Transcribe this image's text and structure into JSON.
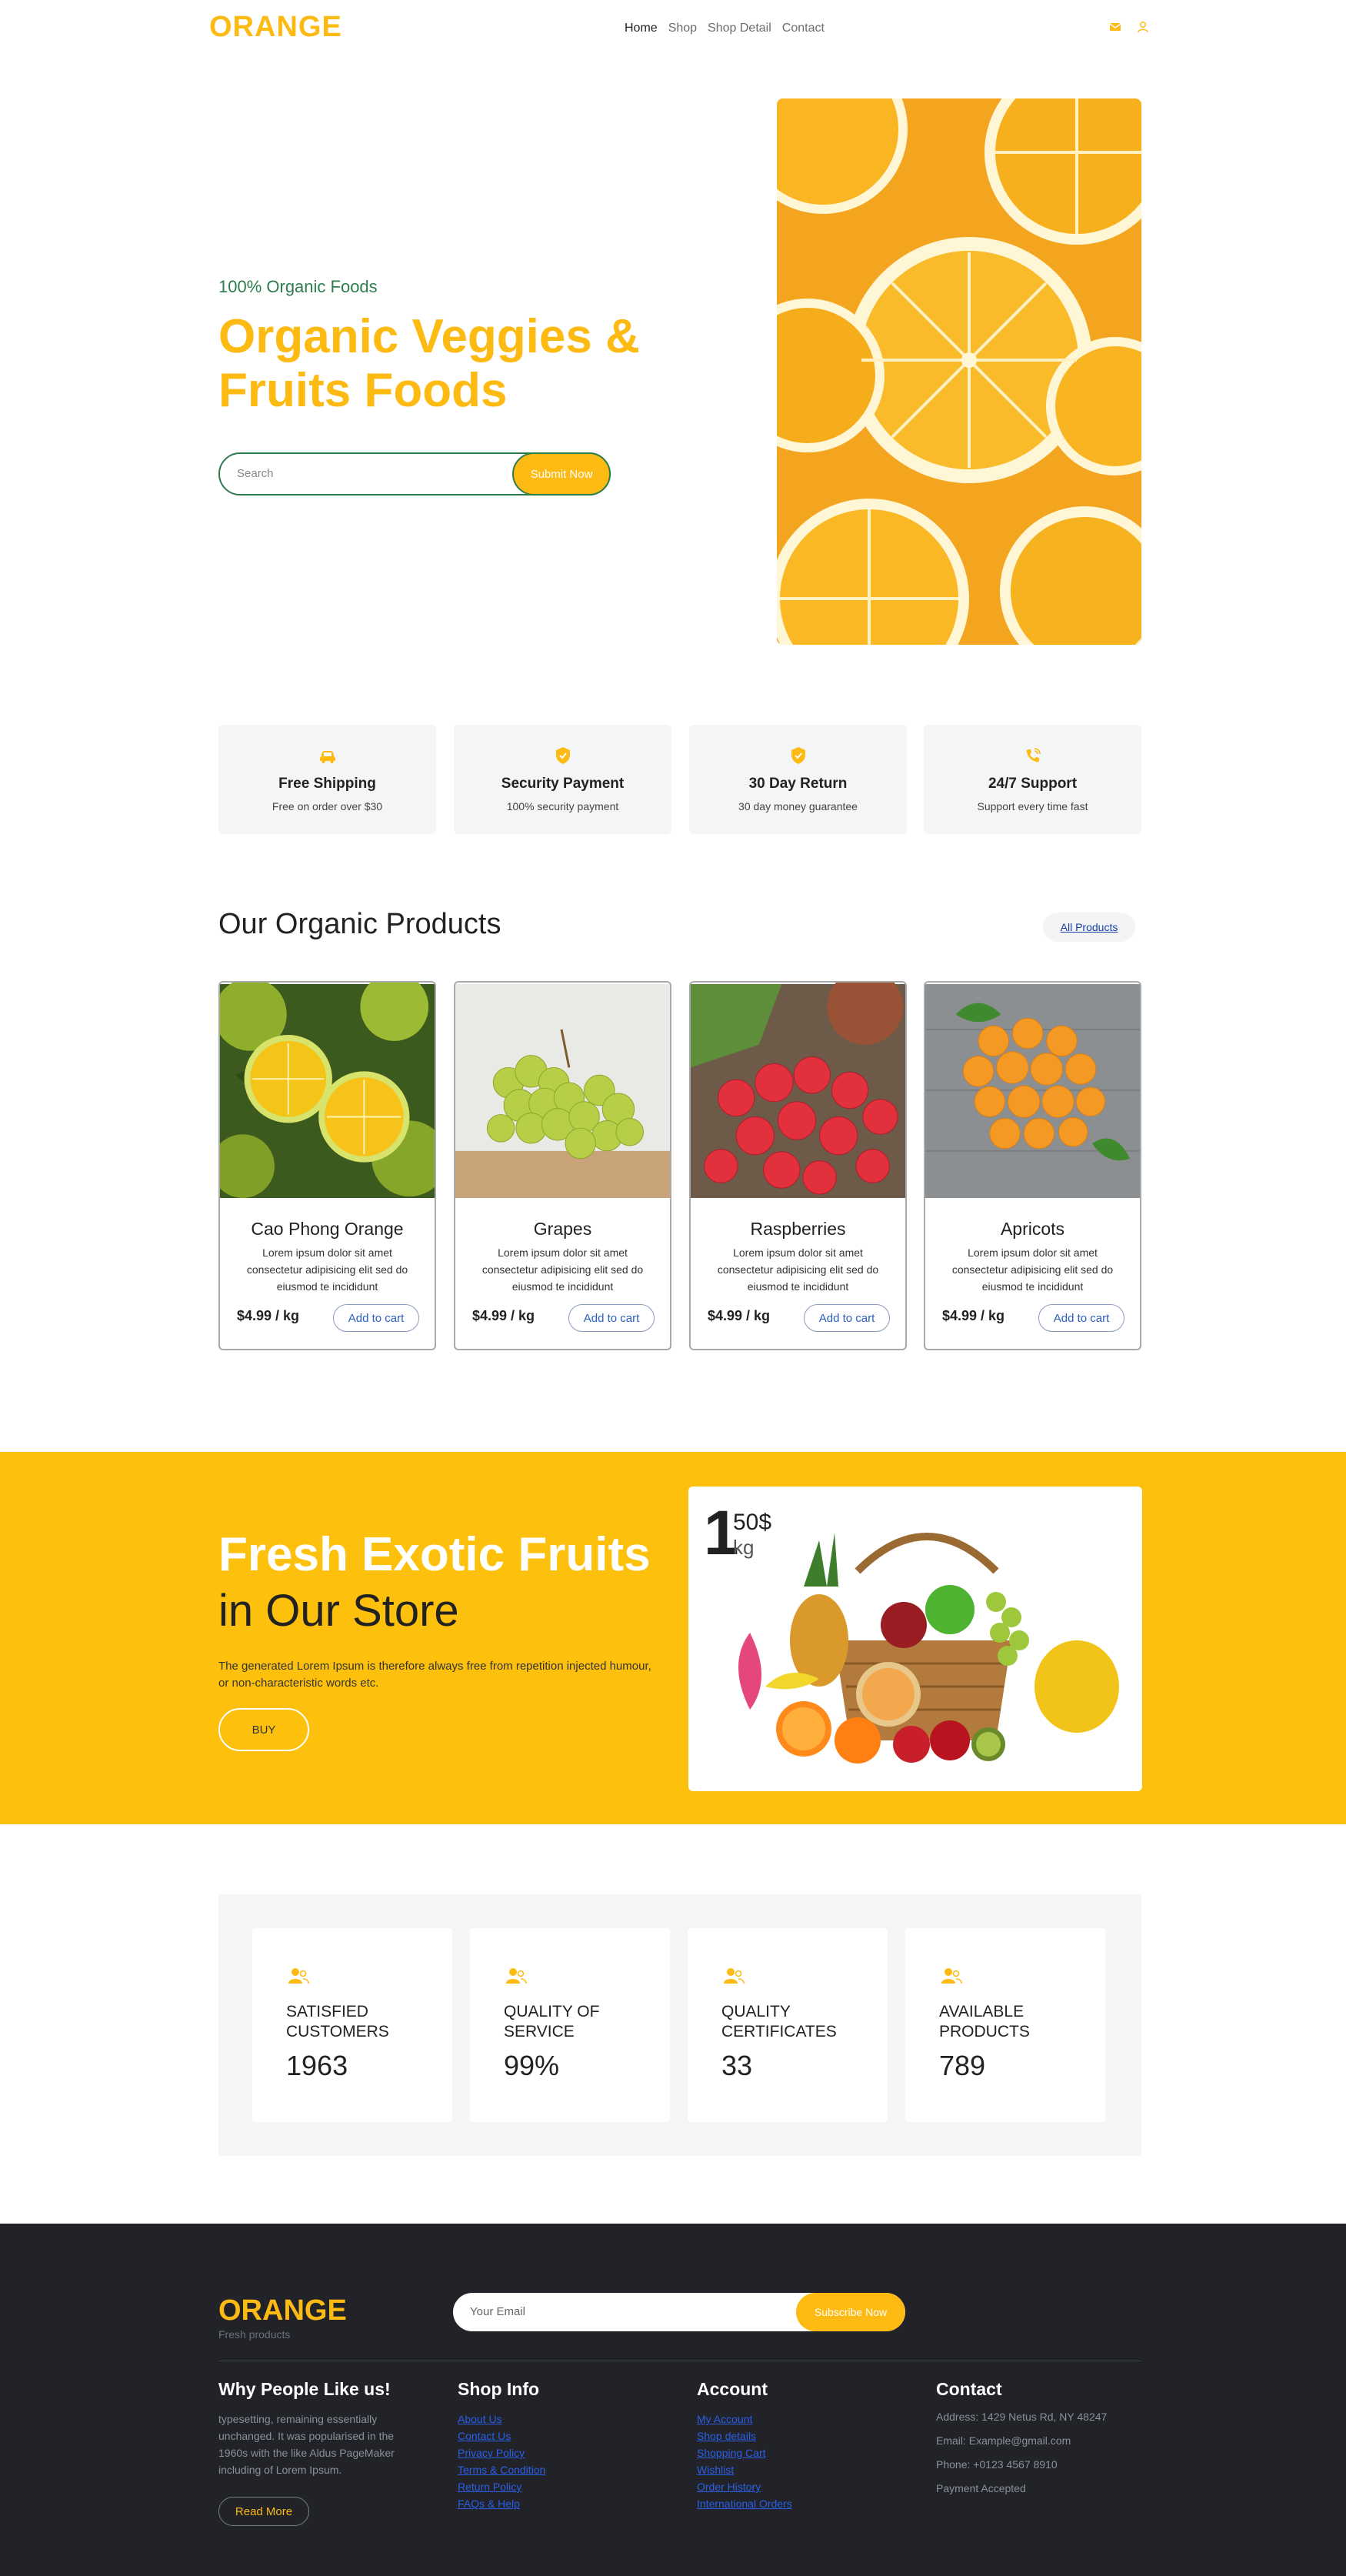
{
  "brand": "ORANGE",
  "colors": {
    "accent": "#fdba12",
    "green": "#2e7d4f",
    "footer_bg": "#212329",
    "banner_bg": "#fdc00c"
  },
  "nav": {
    "items": [
      "Home",
      "Shop",
      "Shop Detail",
      "Contact"
    ],
    "active": "Home",
    "icons": [
      "mail-icon",
      "user-icon"
    ]
  },
  "hero": {
    "subtitle": "100% Organic Foods",
    "title": "Organic Veggies & Fruits Foods",
    "search_placeholder": "Search",
    "submit_label": "Submit Now"
  },
  "features": [
    {
      "icon": "car-icon",
      "title": "Free Shipping",
      "desc": "Free on order over $30"
    },
    {
      "icon": "shield-check-icon",
      "title": "Security Payment",
      "desc": "100% security payment"
    },
    {
      "icon": "shield-check-icon",
      "title": "30 Day Return",
      "desc": "30 day money guarantee"
    },
    {
      "icon": "phone-ring-icon",
      "title": "24/7 Support",
      "desc": "Support every time fast"
    }
  ],
  "products": {
    "title": "Our Organic Products",
    "all_label": "All Products",
    "items": [
      {
        "name": "Cao Phong Orange",
        "desc": "Lorem ipsum dolor sit amet consectetur adipisicing elit sed do eiusmod te incididunt",
        "price": "$4.99 / kg",
        "button": "Add to cart"
      },
      {
        "name": "Grapes",
        "desc": "Lorem ipsum dolor sit amet consectetur adipisicing elit sed do eiusmod te incididunt",
        "price": "$4.99 / kg",
        "button": "Add to cart"
      },
      {
        "name": "Raspberries",
        "desc": "Lorem ipsum dolor sit amet consectetur adipisicing elit sed do eiusmod te incididunt",
        "price": "$4.99 / kg",
        "button": "Add to cart"
      },
      {
        "name": "Apricots",
        "desc": "Lorem ipsum dolor sit amet consectetur adipisicing elit sed do eiusmod te incididunt",
        "price": "$4.99 / kg",
        "button": "Add to cart"
      }
    ]
  },
  "banner": {
    "title_line1": "Fresh Exotic Fruits",
    "title_line2": "in Our Store",
    "desc": "The generated Lorem Ipsum is therefore always free from repetition injected humour, or non-characteristic words etc.",
    "button": "BUY",
    "price_big": "1",
    "price_small": "50$",
    "price_unit": "kg"
  },
  "stats": [
    {
      "label": "SATISFIED CUSTOMERS",
      "value": "1963"
    },
    {
      "label": "QUALITY OF SERVICE",
      "value": "99%"
    },
    {
      "label": "QUALITY CERTIFICATES",
      "value": "33"
    },
    {
      "label": "AVAILABLE PRODUCTS",
      "value": "789"
    }
  ],
  "footer": {
    "logo": "ORANGE",
    "tagline": "Fresh products",
    "email_placeholder": "Your Email",
    "subscribe_label": "Subscribe Now",
    "why": {
      "title": "Why People Like us!",
      "text": "typesetting, remaining essentially unchanged. It was popularised in the 1960s with the like Aldus PageMaker including of Lorem Ipsum.",
      "button": "Read More"
    },
    "shop_info": {
      "title": "Shop Info",
      "links": [
        "About Us",
        "Contact Us",
        "Privacy Policy",
        "Terms & Condition",
        "Return Policy",
        "FAQs & Help"
      ]
    },
    "account": {
      "title": "Account",
      "links": [
        "My Account",
        "Shop details",
        "Shopping Cart",
        "Wishlist",
        "Order History",
        "International Orders"
      ]
    },
    "contact": {
      "title": "Contact",
      "lines": [
        "Address: 1429 Netus Rd, NY 48247",
        "Email: Example@gmail.com",
        "Phone: +0123 4567 8910",
        "Payment Accepted"
      ]
    }
  }
}
